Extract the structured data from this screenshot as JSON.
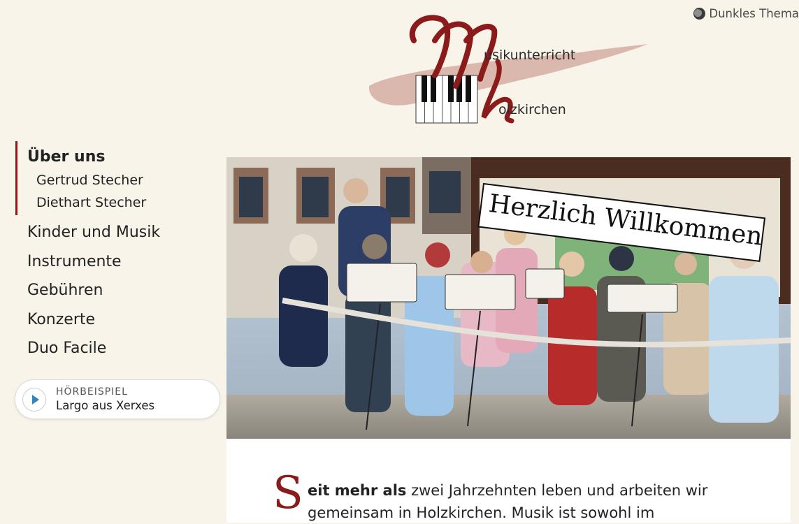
{
  "theme_toggle": {
    "label": "Dunkles Thema",
    "icon": "moon-icon"
  },
  "logo": {
    "line1": "usikunterricht",
    "line2": "olzkirchen",
    "initial1": "M",
    "initial2": "h",
    "brand_color": "#8b1a1a"
  },
  "nav": {
    "active": "Über uns",
    "sub_items": [
      "Gertrud Stecher",
      "Diethart Stecher"
    ],
    "items": [
      "Kinder und Musik",
      "Instrumente",
      "Gebühren",
      "Konzerte",
      "Duo Facile"
    ]
  },
  "player": {
    "label": "HÖRBEISPIEL",
    "title": "Largo aus Xerxes",
    "icon": "play-icon"
  },
  "hero": {
    "sign": "Herzlich Willkommen"
  },
  "content": {
    "dropcap": "S",
    "bold": "eit mehr als",
    "rest": " zwei Jahrzehnten leben und arbeiten wir",
    "line2": "gemeinsam in Holzkirchen. Musik ist sowohl im"
  },
  "colors": {
    "accent": "#8b1a1a",
    "background": "#f9f4ea",
    "play": "#2e86c1"
  }
}
